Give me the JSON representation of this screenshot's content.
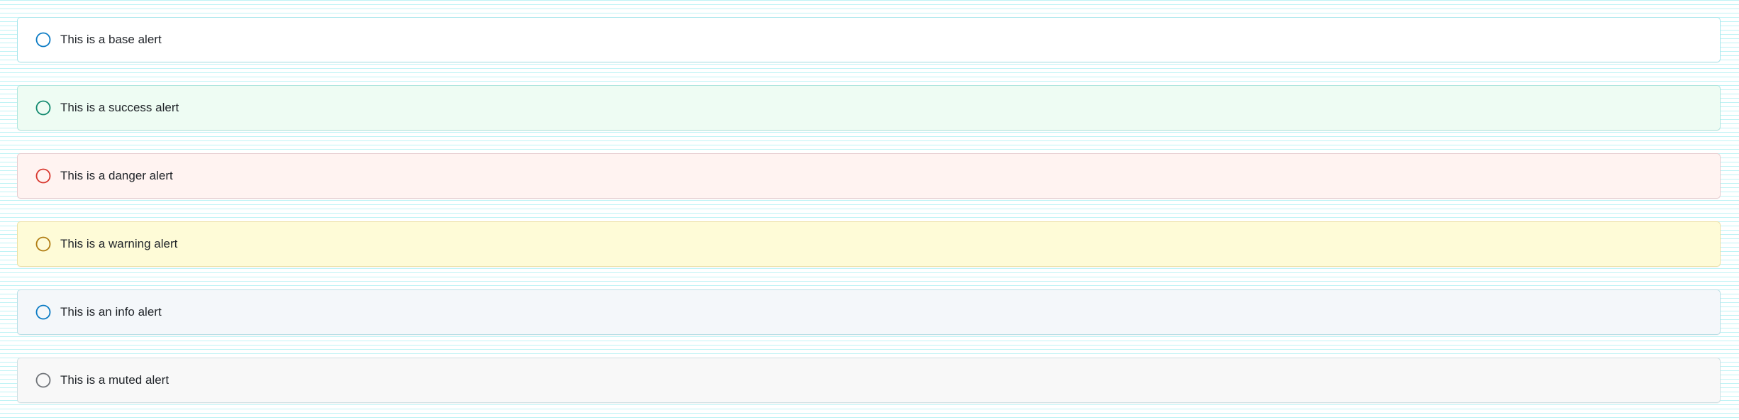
{
  "alerts": [
    {
      "variant": "base",
      "text": "This is a base alert",
      "icon": "circle-icon",
      "icon_color": "#0b7bc4"
    },
    {
      "variant": "success",
      "text": "This is a success alert",
      "icon": "circle-icon",
      "icon_color": "#138a6f"
    },
    {
      "variant": "danger",
      "text": "This is a danger alert",
      "icon": "circle-icon",
      "icon_color": "#d8372e"
    },
    {
      "variant": "warning",
      "text": "This is a warning alert",
      "icon": "circle-icon",
      "icon_color": "#b07c12"
    },
    {
      "variant": "info",
      "text": "This is an info alert",
      "icon": "circle-icon",
      "icon_color": "#0b7bc4"
    },
    {
      "variant": "muted",
      "text": "This is a muted alert",
      "icon": "circle-icon",
      "icon_color": "#6f7378"
    }
  ]
}
